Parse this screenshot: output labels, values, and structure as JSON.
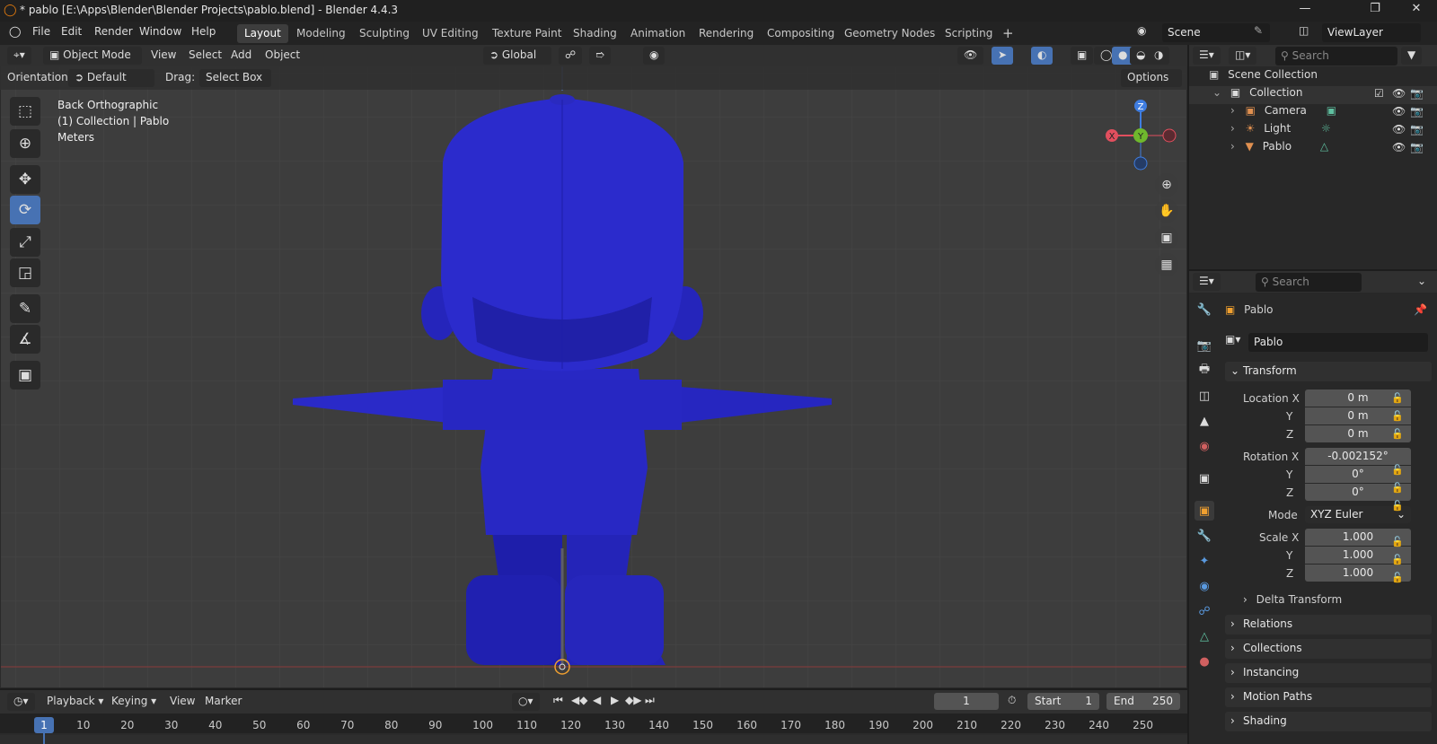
{
  "window": {
    "title": "* pablo [E:\\Apps\\Blender\\Blender Projects\\pablo.blend] - Blender 4.4.3"
  },
  "menu": [
    "File",
    "Edit",
    "Render",
    "Window",
    "Help"
  ],
  "workspaces": [
    "Layout",
    "Modeling",
    "Sculpting",
    "UV Editing",
    "Texture Paint",
    "Shading",
    "Animation",
    "Rendering",
    "Compositing",
    "Geometry Nodes",
    "Scripting"
  ],
  "scene": {
    "name": "Scene",
    "view_layer": "ViewLayer"
  },
  "viewport_header": {
    "mode": "Object Mode",
    "menus": [
      "View",
      "Select",
      "Add",
      "Object"
    ],
    "transform_orientation": "Global"
  },
  "tool_settings": {
    "orientation_label": "Orientation:",
    "orientation_value": "Default",
    "drag_label": "Drag:",
    "drag_value": "Select Box",
    "options": "Options"
  },
  "overlay_text": {
    "line1": "Back Orthographic",
    "line2": "(1) Collection | Pablo",
    "line3": "Meters"
  },
  "gizmo": {
    "x": "X",
    "y": "Y",
    "z": "Z"
  },
  "outliner": {
    "search_placeholder": "Search",
    "root": "Scene Collection",
    "collection": "Collection",
    "items": [
      {
        "name": "Camera"
      },
      {
        "name": "Light"
      },
      {
        "name": "Pablo"
      }
    ]
  },
  "properties": {
    "search_placeholder": "Search",
    "object_name": "Pablo",
    "data_name": "Pablo",
    "transform_title": "Transform",
    "location_label": "Location X",
    "location": [
      "0 m",
      "0 m",
      "0 m"
    ],
    "rotation_label": "Rotation X",
    "rotation": [
      "-0.002152°",
      "0°",
      "0°"
    ],
    "mode_label": "Mode",
    "mode": "XYZ Euler",
    "scale_label": "Scale X",
    "scale": [
      "1.000",
      "1.000",
      "1.000"
    ],
    "axis_y": "Y",
    "axis_z": "Z",
    "delta": "Delta Transform",
    "panels": [
      "Relations",
      "Collections",
      "Instancing",
      "Motion Paths",
      "Shading"
    ]
  },
  "timeline": {
    "menus": [
      "Playback",
      "Keying",
      "View",
      "Marker"
    ],
    "current_frame": "1",
    "start_label": "Start",
    "start": "1",
    "end_label": "End",
    "end": "250",
    "ticks": [
      "1",
      "10",
      "20",
      "30",
      "40",
      "50",
      "60",
      "70",
      "80",
      "90",
      "100",
      "110",
      "120",
      "130",
      "140",
      "150",
      "160",
      "170",
      "180",
      "190",
      "200",
      "210",
      "220",
      "230",
      "240",
      "250"
    ]
  },
  "colors": {
    "mesh": "#2323c8",
    "accent": "#4772b3",
    "axis_x": "#e14f5e",
    "axis_y": "#6fb82d",
    "axis_z": "#3f7de0"
  }
}
